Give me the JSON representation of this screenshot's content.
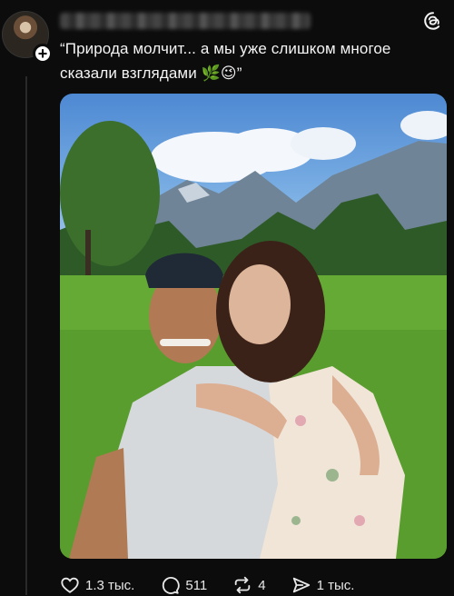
{
  "post": {
    "caption": "“Природа молчит... а мы уже слишком многое сказали взглядами 🌿😉”",
    "photo_alt": "Couple selfie in a mountain meadow"
  },
  "actions": {
    "likes": "1.3 тыс.",
    "comments": "511",
    "reposts": "4",
    "shares": "1 тыс."
  },
  "icons": {
    "like": "heart-icon",
    "comment": "comment-bubble-icon",
    "repost": "repost-icon",
    "share": "send-icon",
    "app": "threads-logo-icon",
    "follow": "plus-icon"
  },
  "colors": {
    "background": "#0c0c0c",
    "text": "#f3f3f3"
  }
}
